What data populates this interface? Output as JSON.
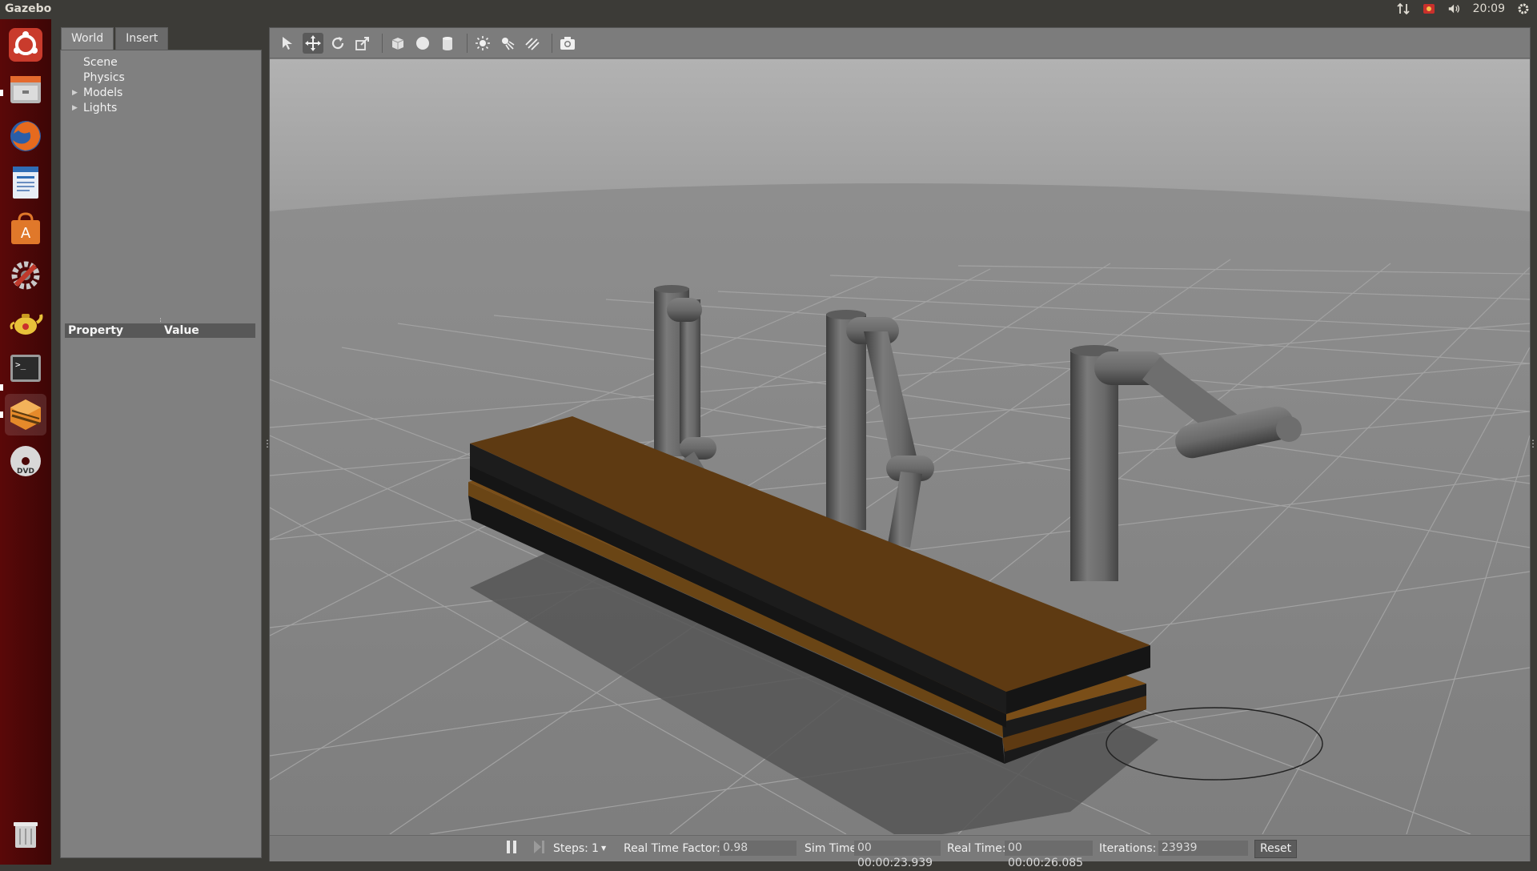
{
  "topbar": {
    "app_title": "Gazebo",
    "clock": "20:09",
    "icons": [
      "network-icon",
      "mail-indicator-icon",
      "volume-icon",
      "gear-icon"
    ]
  },
  "launcher": {
    "items": [
      "ubuntu-dash-icon",
      "files-icon",
      "firefox-icon",
      "writer-icon",
      "software-center-icon",
      "system-settings-icon",
      "teapot-icon",
      "terminal-icon",
      "gazebo-icon",
      "dvd-icon",
      "trash-icon"
    ]
  },
  "left_panel": {
    "tabs": [
      "World",
      "Insert"
    ],
    "tree": [
      "Scene",
      "Physics",
      "Models",
      "Lights"
    ],
    "property_header": {
      "property": "Property",
      "value": "Value"
    }
  },
  "toolbar": {
    "tools": [
      "select-icon",
      "translate-icon",
      "rotate-icon",
      "scale-icon",
      "box-icon",
      "sphere-icon",
      "cylinder-icon",
      "point-light-icon",
      "spot-light-icon",
      "directional-light-icon",
      "screenshot-icon"
    ],
    "active_tool": "translate-icon"
  },
  "bottom_bar": {
    "steps_label": "Steps:",
    "steps_value": "1",
    "real_time_factor_label": "Real Time Factor:",
    "real_time_factor_value": "0.98",
    "sim_time_label": "Sim Time:",
    "sim_time_value": "00 00:00:23.939",
    "real_time_label": "Real Time:",
    "real_time_value": "00 00:00:26.085",
    "iterations_label": "Iterations:",
    "iterations_value": "23939",
    "reset_label": "Reset"
  },
  "colors": {
    "launcher_bg": "#4a0707",
    "panel_bg": "#808080",
    "wood": "#5e3a12",
    "robot_gray": "#6e6e6e"
  }
}
